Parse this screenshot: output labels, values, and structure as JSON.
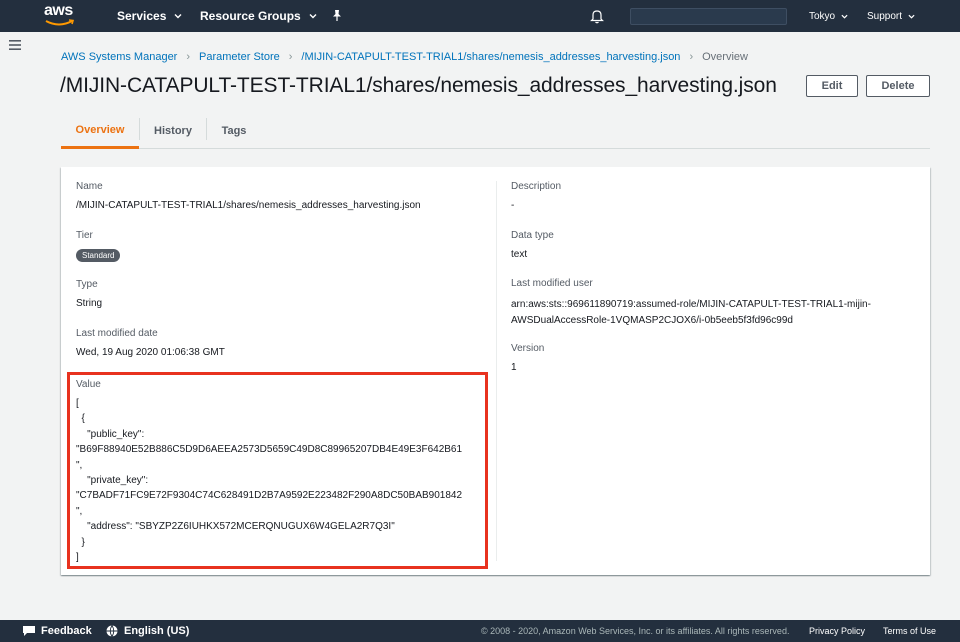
{
  "topnav": {
    "logo_text": "aws",
    "services_label": "Services",
    "resource_groups_label": "Resource Groups",
    "region_label": "Tokyo",
    "support_label": "Support"
  },
  "breadcrumb": {
    "items": [
      "AWS Systems Manager",
      "Parameter Store",
      "/MIJIN-CATAPULT-TEST-TRIAL1/shares/nemesis_addresses_harvesting.json"
    ],
    "current": "Overview"
  },
  "page": {
    "title": "/MIJIN-CATAPULT-TEST-TRIAL1/shares/nemesis_addresses_harvesting.json",
    "edit_label": "Edit",
    "delete_label": "Delete"
  },
  "tabs": [
    {
      "label": "Overview",
      "active": true
    },
    {
      "label": "History",
      "active": false
    },
    {
      "label": "Tags",
      "active": false
    }
  ],
  "details": {
    "name_label": "Name",
    "name_value": "/MIJIN-CATAPULT-TEST-TRIAL1/shares/nemesis_addresses_harvesting.json",
    "tier_label": "Tier",
    "tier_value": "Standard",
    "type_label": "Type",
    "type_value": "String",
    "last_modified_date_label": "Last modified date",
    "last_modified_date_value": "Wed, 19 Aug 2020 01:06:38 GMT",
    "value_label": "Value",
    "value_content": "[\n  {\n    \"public_key\":\n\"B69F88940E52B886C5D9D6AEEA2573D5659C49D8C89965207DB4E49E3F642B61\n\",\n    \"private_key\":\n\"C7BADF71FC9E72F9304C74C628491D2B7A9592E223482F290A8DC50BAB901842\n\",\n    \"address\": \"SBYZP2Z6IUHKX572MCERQNUGUX6W4GELA2R7Q3I\"\n  }\n]",
    "description_label": "Description",
    "description_value": "-",
    "data_type_label": "Data type",
    "data_type_value": "text",
    "last_modified_user_label": "Last modified user",
    "last_modified_user_value": "arn:aws:sts::969611890719:assumed-role/MIJIN-CATAPULT-TEST-TRIAL1-mijin-AWSDualAccessRole-1VQMASP2CJOX6/i-0b5eeb5f3fd96c99d",
    "version_label": "Version",
    "version_value": "1"
  },
  "footer": {
    "feedback_label": "Feedback",
    "language_label": "English (US)",
    "copyright": "© 2008 - 2020, Amazon Web Services, Inc. or its affiliates. All rights reserved.",
    "privacy_label": "Privacy Policy",
    "terms_label": "Terms of Use"
  },
  "colors": {
    "nav_bg": "#232f3e",
    "link": "#0073bb",
    "accent": "#ec7211",
    "highlight_box": "#e8321f"
  }
}
